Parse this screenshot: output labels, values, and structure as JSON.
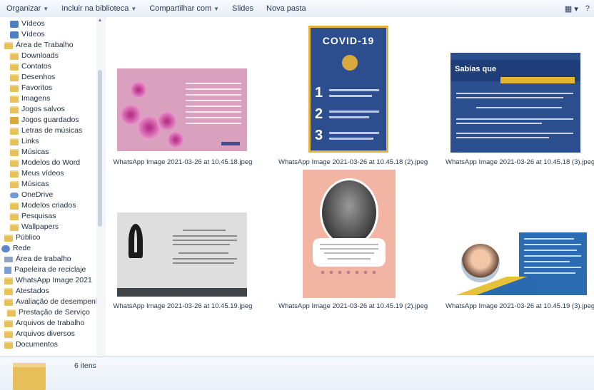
{
  "toolbar": {
    "items": [
      "Organizar",
      "Incluir na biblioteca",
      "Compartilhar com",
      "Slides",
      "Nova pasta"
    ],
    "view_label": "▦ ▾",
    "help_label": "?"
  },
  "sidebar": {
    "items": [
      {
        "label": "Vídeos",
        "icon": "video-icon"
      },
      {
        "label": "Vídeos",
        "icon": "video-icon"
      },
      {
        "label": "Área de Trabalho",
        "icon": "folder-icon"
      },
      {
        "label": "Downloads",
        "icon": "folder-icon"
      },
      {
        "label": "Contatos",
        "icon": "folder-icon"
      },
      {
        "label": "Desenhos",
        "icon": "folder-icon"
      },
      {
        "label": "Favoritos",
        "icon": "folder-icon"
      },
      {
        "label": "Imagens",
        "icon": "folder-icon"
      },
      {
        "label": "Jogos salvos",
        "icon": "folder-icon"
      },
      {
        "label": "Jogos guardados",
        "icon": "folder-icon"
      },
      {
        "label": "Letras de músicas",
        "icon": "folder-icon"
      },
      {
        "label": "Links",
        "icon": "folder-icon"
      },
      {
        "label": "Músicas",
        "icon": "folder-icon"
      },
      {
        "label": "Modelos do Word",
        "icon": "folder-icon"
      },
      {
        "label": "Meus vídeos",
        "icon": "folder-icon"
      },
      {
        "label": "Músicas",
        "icon": "folder-icon"
      },
      {
        "label": "OneDrive",
        "icon": "cloud-icon"
      },
      {
        "label": "Modelos criados",
        "icon": "folder-icon"
      },
      {
        "label": "Pesquisas",
        "icon": "folder-icon"
      },
      {
        "label": "Wallpapers",
        "icon": "folder-icon"
      },
      {
        "label": "Público",
        "icon": "folder-icon"
      },
      {
        "label": "Rede",
        "icon": "network-icon"
      },
      {
        "label": "Área de trabalho",
        "icon": "desktop-icon"
      },
      {
        "label": "Papeleira de reciclaje",
        "icon": "recycle-bin-icon"
      },
      {
        "label": "WhatsApp Image 2021",
        "icon": "folder-icon"
      },
      {
        "label": "Atestados",
        "icon": "folder-icon"
      },
      {
        "label": "Avaliação de desempenho",
        "icon": "folder-icon"
      },
      {
        "label": "Prestação de Serviço",
        "icon": "folder-icon"
      },
      {
        "label": "Arquivos de trabalho",
        "icon": "folder-icon"
      },
      {
        "label": "Arquivos diversos",
        "icon": "folder-icon"
      },
      {
        "label": "Documentos",
        "icon": "folder-icon"
      }
    ]
  },
  "files": [
    {
      "name": "WhatsApp Image 2021-03-26 at 10.45.18.jpeg"
    },
    {
      "name": "WhatsApp Image 2021-03-26 at 10.45.18 (2).jpeg"
    },
    {
      "name": "WhatsApp Image 2021-03-26 at 10.45.18 (3).jpeg"
    },
    {
      "name": "WhatsApp Image 2021-03-26 at 10.45.19.jpeg"
    },
    {
      "name": "WhatsApp Image 2021-03-26 at 10.45.19 (2).jpeg"
    },
    {
      "name": "WhatsApp Image 2021-03-26 at 10.45.19 (3).jpeg"
    }
  ],
  "thumb_text": {
    "covid_title": "COVID-19",
    "covid_nums": [
      "1",
      "2",
      "3"
    ],
    "sabias_title": "Sabías que"
  },
  "details": {
    "count_label": "6 itens"
  }
}
